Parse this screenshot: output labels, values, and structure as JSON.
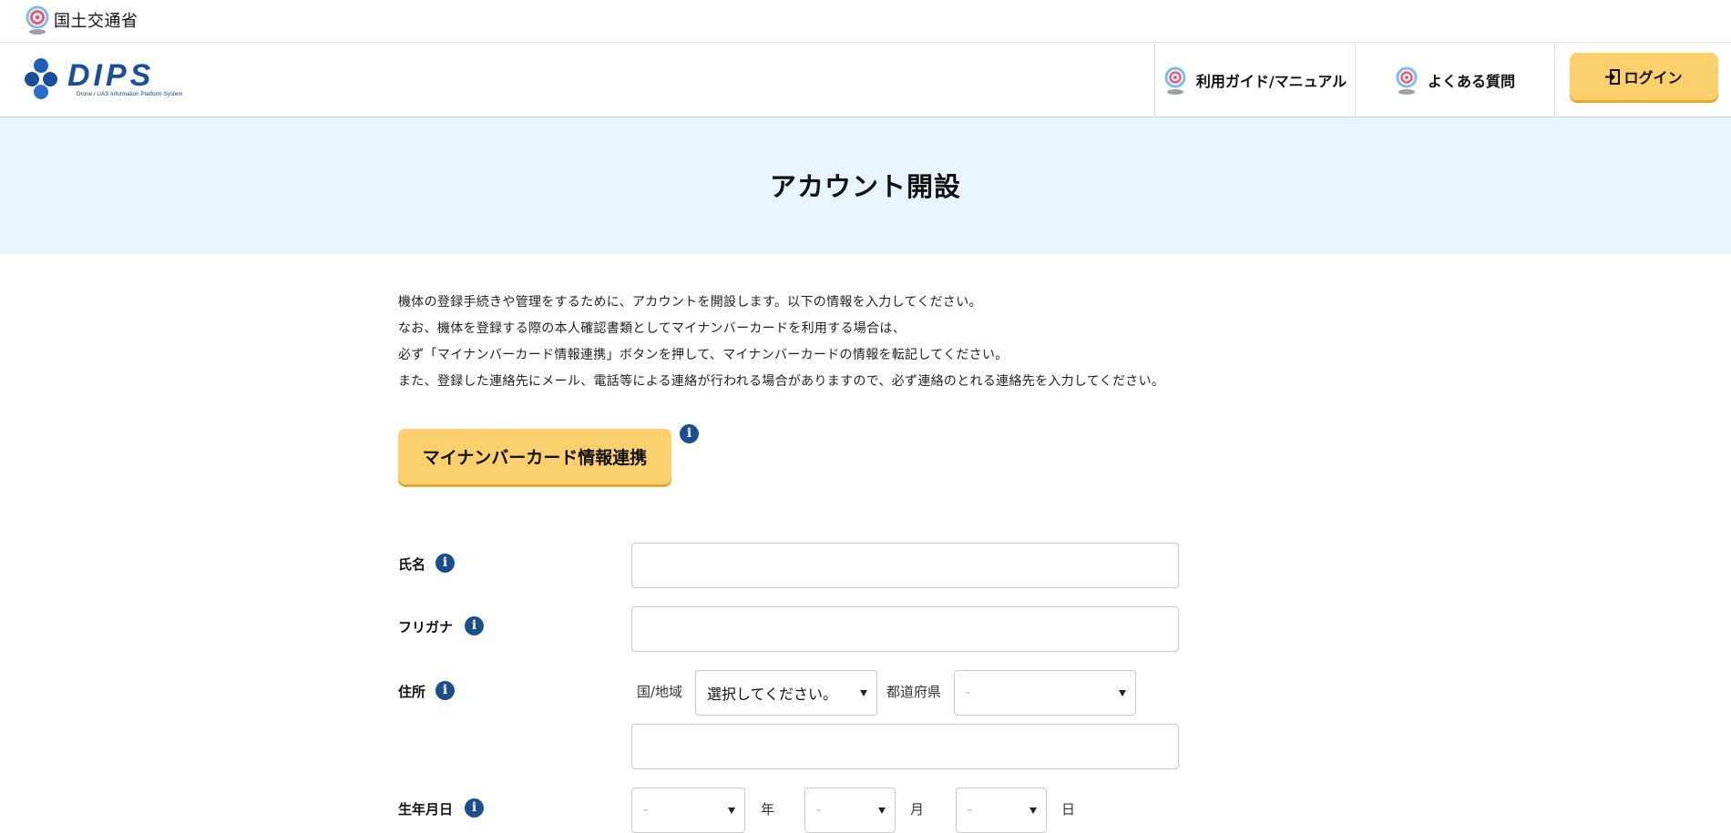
{
  "gov": {
    "name": "国土交通省"
  },
  "header": {
    "logo_text": "DIPS",
    "logo_subtitle": "Drone / UAS Information Platform System",
    "nav": {
      "guide": "利用ガイド/マニュアル",
      "faq": "よくある質問",
      "login": "ログイン"
    }
  },
  "page": {
    "title": "アカウント開設"
  },
  "intro": [
    "機体の登録手続きや管理をするために、アカウントを開設します。以下の情報を入力してください。",
    "なお、機体を登録する際の本人確認書類としてマイナンバーカードを利用する場合は、",
    "必ず「マイナンバーカード情報連携」ボタンを押して、マイナンバーカードの情報を転記してください。",
    "また、登録した連絡先にメール、電話等による連絡が行われる場合がありますので、必ず連絡のとれる連絡先を入力してください。"
  ],
  "mynumber_button": "マイナンバーカード情報連携",
  "info_glyph": "i",
  "form": {
    "name": {
      "label": "氏名",
      "value": ""
    },
    "kana": {
      "label": "フリガナ",
      "value": ""
    },
    "address": {
      "label": "住所",
      "country_label": "国/地域",
      "country_value": "選択してください。",
      "prefecture_label": "都道府県",
      "prefecture_value": "-",
      "line_value": ""
    },
    "birth": {
      "label": "生年月日",
      "year_value": "-",
      "year_label": "年",
      "month_value": "-",
      "month_label": "月",
      "day_value": "-",
      "day_label": "日"
    }
  },
  "colors": {
    "accent_yellow": "#fdd06e",
    "band_blue": "#e8f5fd",
    "info_blue": "#1b4e8c",
    "logo_blue": "#1a4f9c"
  },
  "icons": {
    "gov_logo": "mlit-logo-icon",
    "nav_icon": "mlit-logo-icon",
    "login_icon": "login-icon",
    "info": "info-icon",
    "select_caret": "caret-down-icon"
  }
}
